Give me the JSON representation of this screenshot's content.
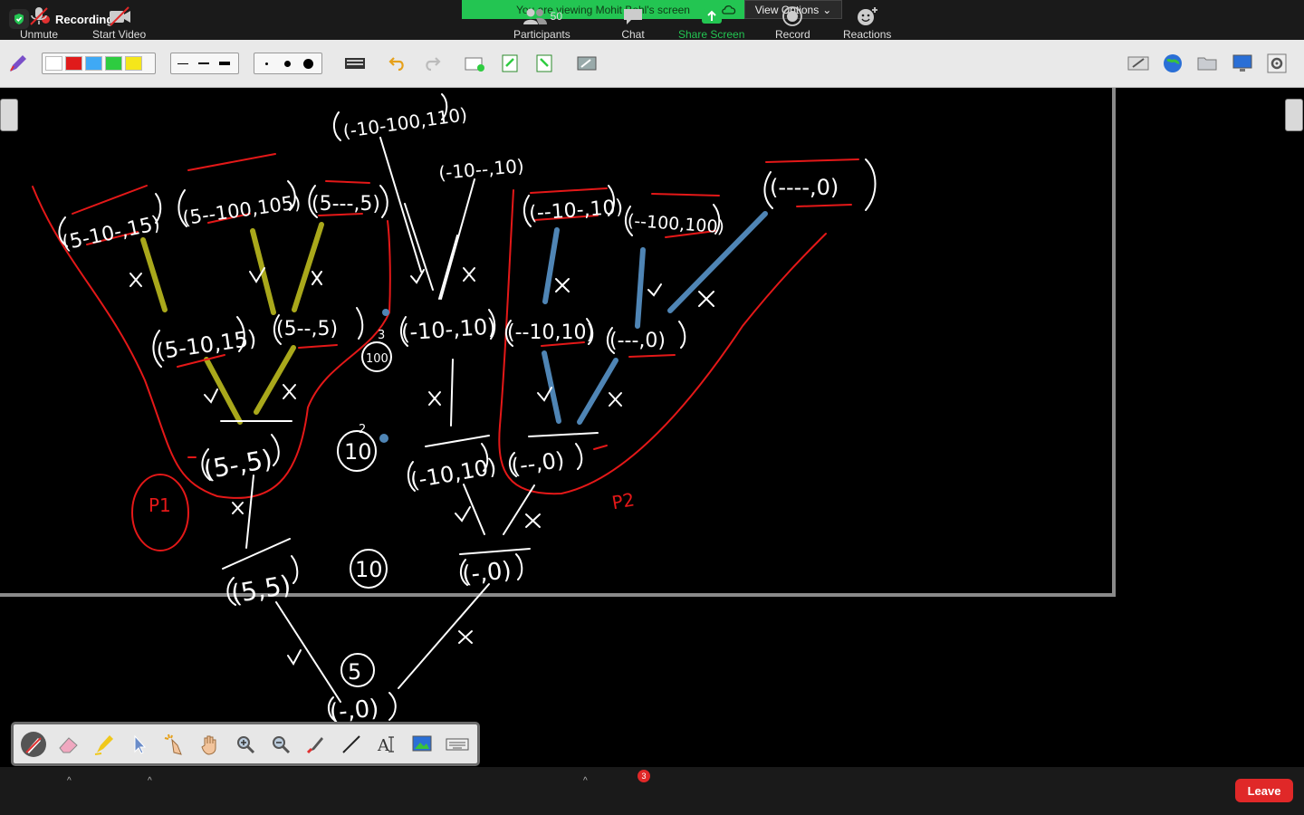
{
  "top": {
    "recording_label": "Recording",
    "banner_text": "You are viewing Mohit Behl's screen",
    "view_options_label": "View Options"
  },
  "toolbar": {
    "colors": [
      "#ffffff",
      "#e01b1b",
      "#3fa9f5",
      "#2ecc40",
      "#f5e61b"
    ],
    "line_widths": [
      "thin",
      "medium",
      "thick"
    ],
    "dot_sizes": [
      "small",
      "medium",
      "large"
    ]
  },
  "whiteboard": {
    "nodes": [
      {
        "id": "root",
        "text": "(-10-100,110)"
      },
      {
        "id": "n2",
        "text": "(-10--,10)"
      },
      {
        "id": "a1",
        "text": "(5-10-,15)"
      },
      {
        "id": "a2",
        "text": "(5--100,105)"
      },
      {
        "id": "a3",
        "text": "(5---,5)"
      },
      {
        "id": "a4",
        "text": "(--10-,10)"
      },
      {
        "id": "a5",
        "text": "(--100,100)"
      },
      {
        "id": "a6",
        "text": "(----,0)"
      },
      {
        "id": "b1",
        "text": "(5-10,15)"
      },
      {
        "id": "b2",
        "text": "(5--,5)"
      },
      {
        "id": "b3",
        "text": "(-10-,10)"
      },
      {
        "id": "b4",
        "text": "(--10,10)"
      },
      {
        "id": "b5",
        "text": "(---,0)"
      },
      {
        "id": "c1",
        "text": "(5-,5)"
      },
      {
        "id": "c2",
        "text": "(-10,10)"
      },
      {
        "id": "c3",
        "text": "(--,0)"
      },
      {
        "id": "d1",
        "text": "(5,5)"
      },
      {
        "id": "d2",
        "text": "(-,0)"
      },
      {
        "id": "e1",
        "text": "(-,0)"
      }
    ],
    "side_values": [
      "100",
      "10",
      "10",
      "5",
      "3",
      "2"
    ],
    "labels": {
      "p1": "P1",
      "p2": "P2"
    }
  },
  "palette": {
    "tools": [
      "pen-icon",
      "eraser-icon",
      "highlighter-icon",
      "pointer-icon",
      "magic-pointer-icon",
      "hand-icon",
      "zoom-in-icon",
      "zoom-out-icon",
      "brush-icon",
      "line-icon",
      "text-icon",
      "image-icon",
      "keyboard-icon"
    ]
  },
  "bottom": {
    "unmute": "Unmute",
    "start_video": "Start Video",
    "participants": "Participants",
    "participant_count": "50",
    "chat": "Chat",
    "chat_badge": "3",
    "share_screen": "Share Screen",
    "record": "Record",
    "reactions": "Reactions",
    "leave": "Leave"
  }
}
